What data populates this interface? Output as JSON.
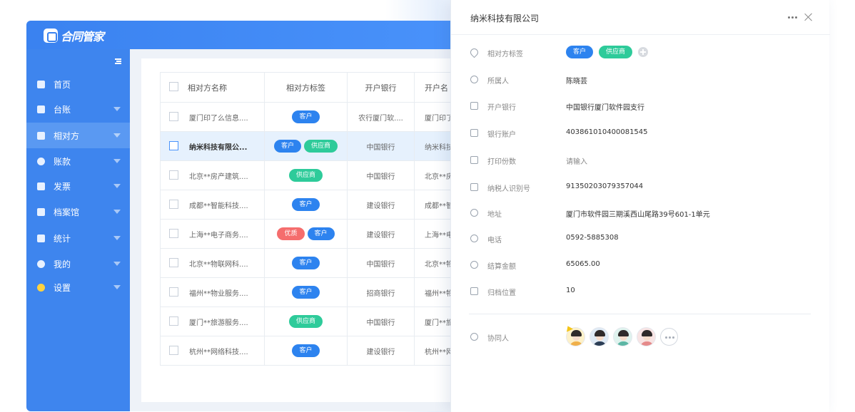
{
  "app": {
    "logo_text": "合同管家"
  },
  "sidebar": {
    "items": [
      {
        "label": "首页",
        "has_arrow": false
      },
      {
        "label": "台账",
        "has_arrow": true
      },
      {
        "label": "相对方",
        "has_arrow": true,
        "active": true
      },
      {
        "label": "账款",
        "has_arrow": true
      },
      {
        "label": "发票",
        "has_arrow": true
      },
      {
        "label": "档案馆",
        "has_arrow": true
      },
      {
        "label": "统计",
        "has_arrow": true
      },
      {
        "label": "我的",
        "has_arrow": true
      },
      {
        "label": "设置",
        "has_arrow": true
      }
    ]
  },
  "table": {
    "headers": [
      "相对方名称",
      "相对方标签",
      "开户银行",
      "开户名"
    ],
    "rows": [
      {
        "name": "厦门印了么信息....",
        "tags": [
          "客户"
        ],
        "bank": "农行厦门软....",
        "account_name": "厦门印了"
      },
      {
        "name": "纳米科技有限公...",
        "tags": [
          "客户",
          "供应商"
        ],
        "bank": "中国银行",
        "account_name": "纳米科技",
        "selected": true
      },
      {
        "name": "北京**房产建筑....",
        "tags": [
          "供应商"
        ],
        "bank": "中国银行",
        "account_name": "北京**房"
      },
      {
        "name": "成都**智能科技....",
        "tags": [
          "客户"
        ],
        "bank": "建设银行",
        "account_name": "成都**智"
      },
      {
        "name": "上海**电子商务....",
        "tags": [
          "优质",
          "客户"
        ],
        "bank": "建设银行",
        "account_name": "上海**电"
      },
      {
        "name": "北京**物联网科....",
        "tags": [
          "客户"
        ],
        "bank": "中国银行",
        "account_name": "北京**物"
      },
      {
        "name": "福州**物业服务....",
        "tags": [
          "客户"
        ],
        "bank": "招商银行",
        "account_name": "福州**物"
      },
      {
        "name": "厦门**旅游服务....",
        "tags": [
          "供应商"
        ],
        "bank": "中国银行",
        "account_name": "厦门**旅"
      },
      {
        "name": "杭州**网络科技....",
        "tags": [
          "客户"
        ],
        "bank": "建设银行",
        "account_name": "杭州**网"
      }
    ]
  },
  "tag_types": {
    "客户": "customer",
    "供应商": "supplier",
    "优质": "premium"
  },
  "panel": {
    "title": "纳米科技有限公司",
    "fields": {
      "tags": {
        "label": "相对方标签",
        "values": [
          "客户",
          "供应商"
        ]
      },
      "owner": {
        "label": "所属人",
        "value": "陈晓芸"
      },
      "bank": {
        "label": "开户银行",
        "value": "中国银行厦门软件园支行"
      },
      "account": {
        "label": "银行账户",
        "value": "403861010400081545"
      },
      "print_copies": {
        "label": "打印份数",
        "placeholder": "请输入"
      },
      "tax_id": {
        "label": "纳税人识别号",
        "value": "91350203079357044"
      },
      "address": {
        "label": "地址",
        "value": "厦门市软件园三期溪西山尾路39号601-1单元"
      },
      "phone": {
        "label": "电话",
        "value": "0592-5885308"
      },
      "settlement": {
        "label": "结算金额",
        "value": "65065.00"
      },
      "archive": {
        "label": "归档位置",
        "value": "10"
      },
      "collaborators": {
        "label": "协同人"
      }
    }
  },
  "colors": {
    "primary": "#3e85ee",
    "customer_tag": "#2d83ef",
    "supplier_tag": "#2ecb9a",
    "premium_tag": "#f56d6d"
  }
}
